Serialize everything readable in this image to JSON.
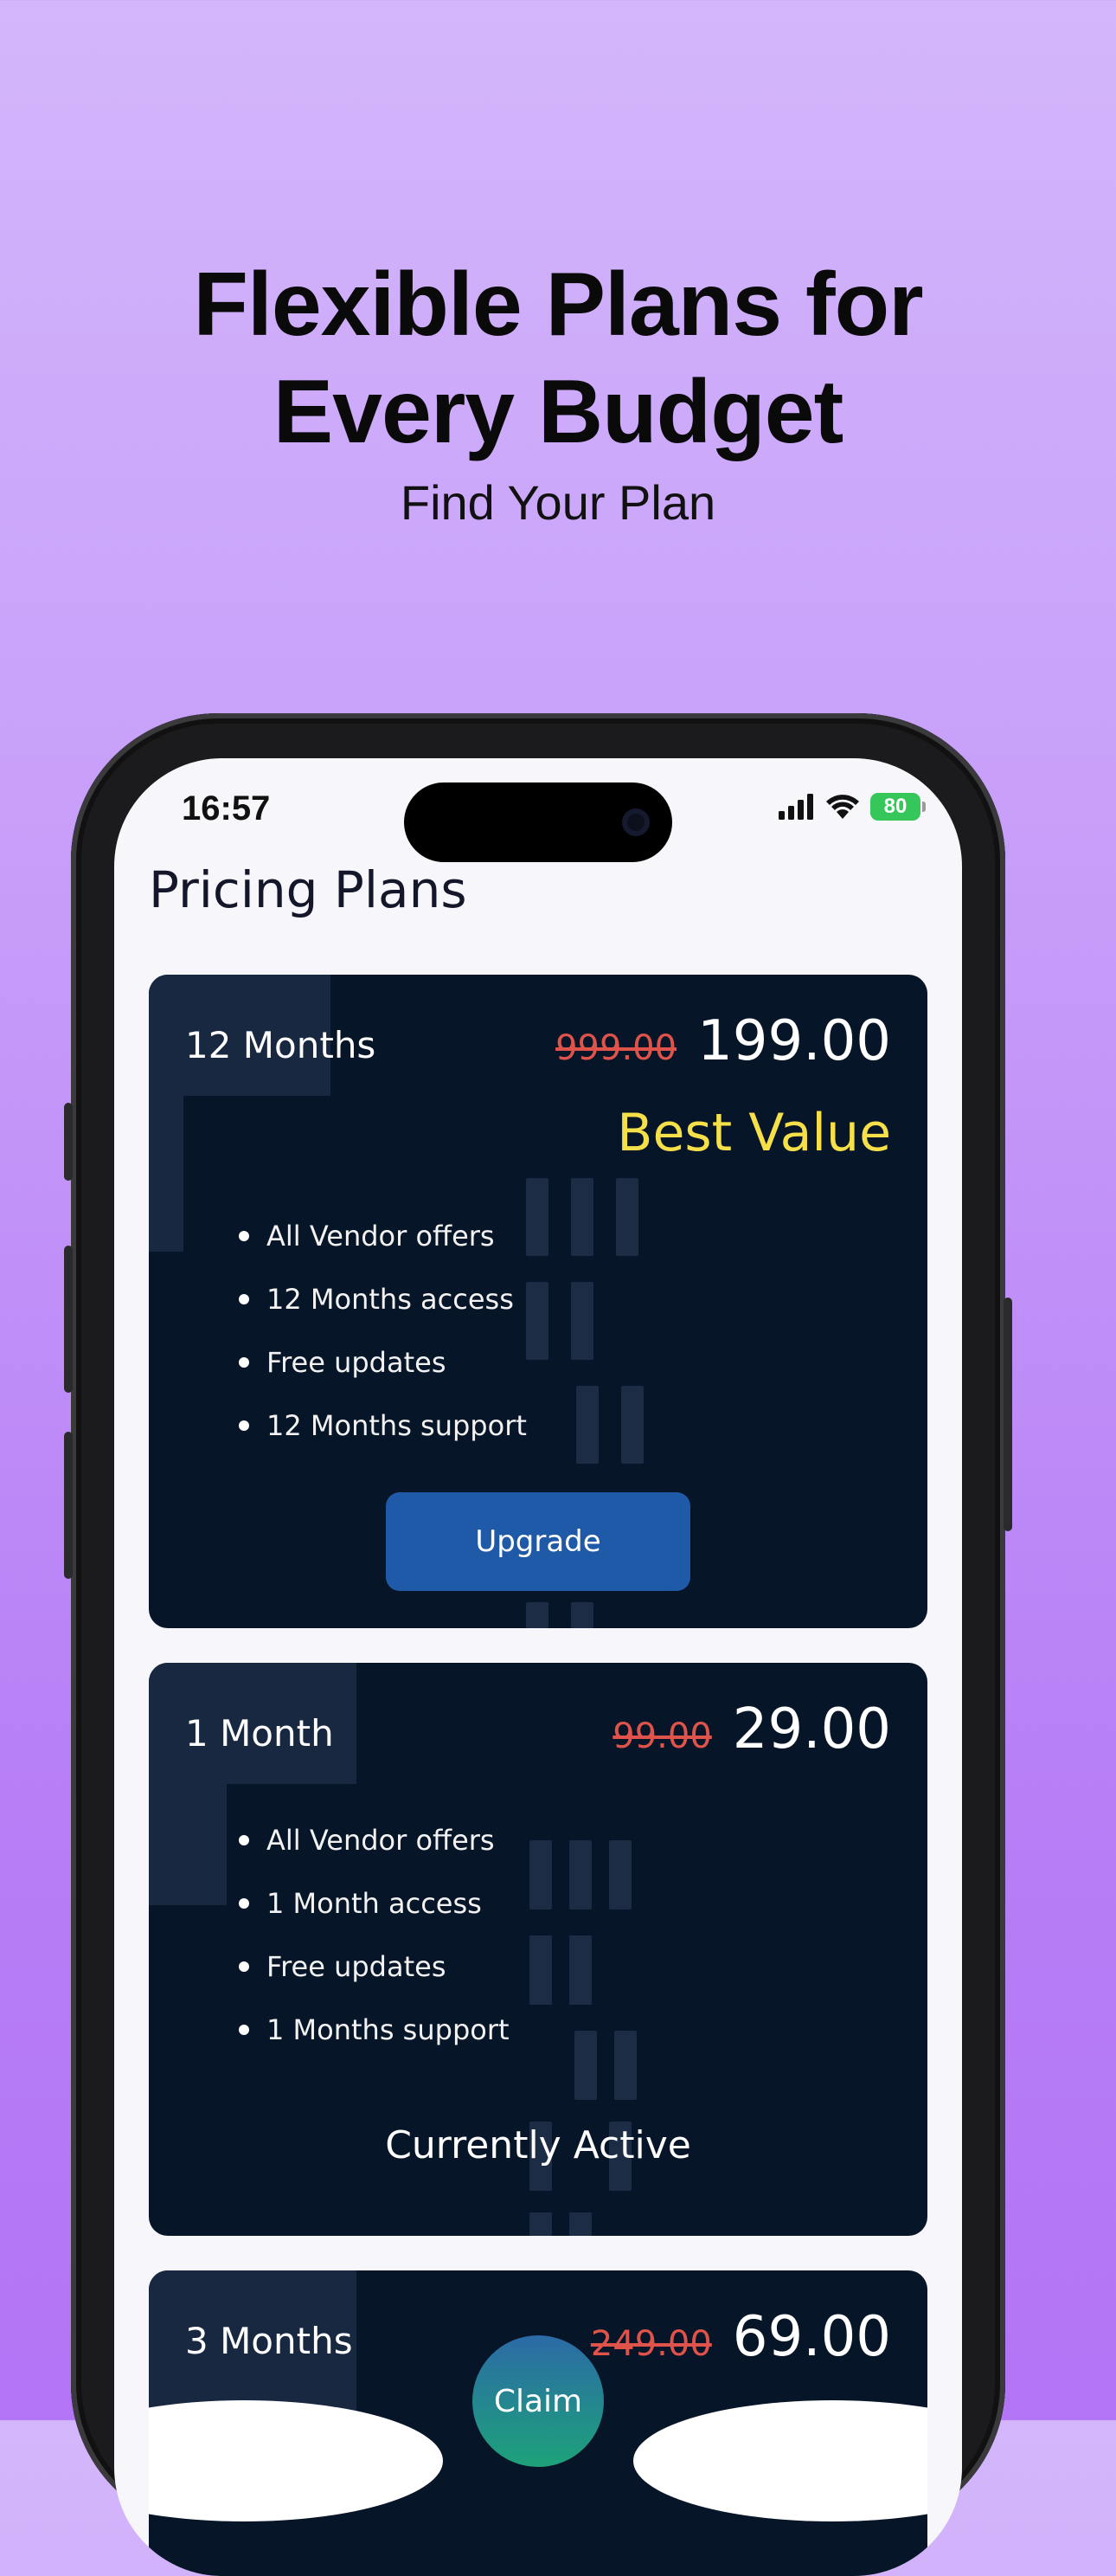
{
  "headline": {
    "line1": "Flexible Plans for",
    "line2": "Every Budget",
    "subtitle": "Find Your Plan"
  },
  "status_bar": {
    "time": "16:57",
    "battery": "80",
    "icons": [
      "signal-icon",
      "wifi-icon",
      "battery-icon"
    ]
  },
  "page": {
    "title": "Pricing Plans"
  },
  "plans": [
    {
      "name": "12 Months",
      "old_price": "999.00",
      "price": "199.00",
      "badge": "Best Value",
      "features": [
        "All Vendor offers",
        "12 Months access",
        "Free updates",
        "12 Months support"
      ],
      "action": "Upgrade"
    },
    {
      "name": "1 Month",
      "old_price": "99.00",
      "price": "29.00",
      "features": [
        "All Vendor offers",
        "1 Month access",
        "Free updates",
        "1 Months support"
      ],
      "status": "Currently Active"
    },
    {
      "name": "3 Months",
      "old_price": "249.00",
      "price": "69.00",
      "action": "Claim"
    }
  ],
  "colors": {
    "card_bg": "#071528",
    "accent_button": "#1f5aa8",
    "best_value": "#f5e049",
    "old_price": "#e0534a"
  }
}
